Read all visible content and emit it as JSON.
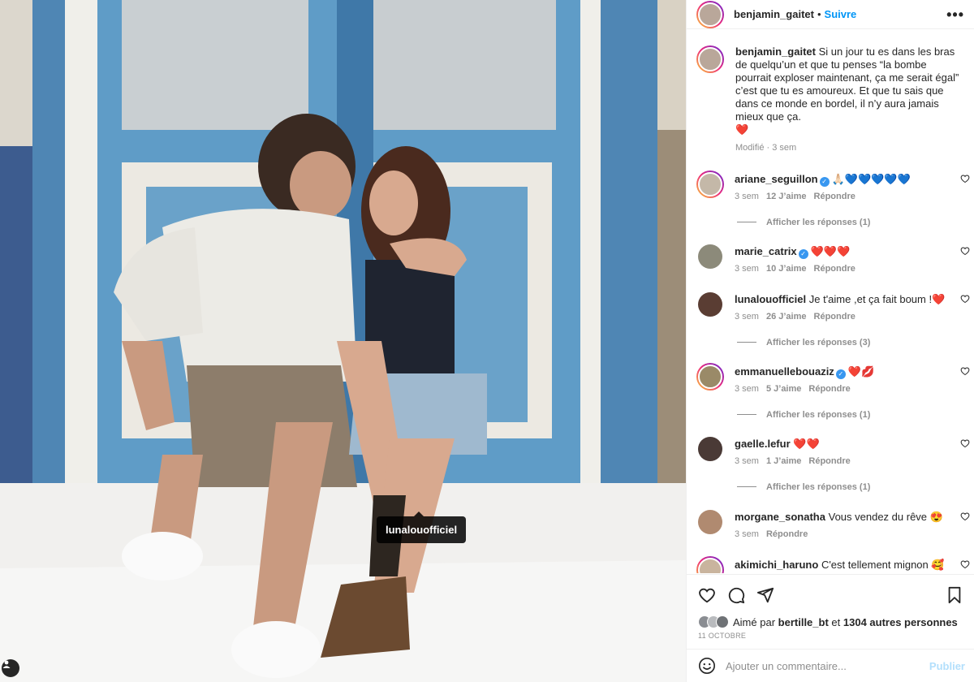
{
  "post": {
    "author": "benjamin_gaitet",
    "follow_label": "Suivre",
    "dot": "•",
    "photo_tag": "lunalouofficiel"
  },
  "caption": {
    "username": "benjamin_gaitet",
    "text": "Si un jour tu es dans les bras de quelqu’un et que tu penses “la bombe pourrait exploser maintenant, ça me serait égal” c’est que tu es amoureux. Et que tu sais que dans ce monde en bordel, il n’y aura jamais mieux que ça.",
    "emoji": "❤️",
    "edited": "Modifié",
    "sep": " · ",
    "time": "3 sem"
  },
  "comments": [
    {
      "username": "ariane_seguillon",
      "verified": true,
      "text": "🙏🏻💙💙💙💙💙",
      "time": "3 sem",
      "likes": "12 J’aime",
      "reply": "Répondre",
      "replies": "Afficher les réponses (1)"
    },
    {
      "username": "marie_catrix",
      "verified": true,
      "text": "❤️❤️❤️",
      "time": "3 sem",
      "likes": "10 J’aime",
      "reply": "Répondre",
      "replies": ""
    },
    {
      "username": "lunalouofficiel",
      "verified": false,
      "text": "Je t'aime ,et ça fait boum !❤️",
      "time": "3 sem",
      "likes": "26 J’aime",
      "reply": "Répondre",
      "replies": "Afficher les réponses (3)"
    },
    {
      "username": "emmanuellebouaziz",
      "verified": true,
      "text": "❤️💋",
      "time": "3 sem",
      "likes": "5 J’aime",
      "reply": "Répondre",
      "replies": "Afficher les réponses (1)"
    },
    {
      "username": "gaelle.lefur",
      "verified": false,
      "text": "❤️❤️",
      "time": "3 sem",
      "likes": "1 J’aime",
      "reply": "Répondre",
      "replies": "Afficher les réponses (1)"
    },
    {
      "username": "morgane_sonatha",
      "verified": false,
      "text": "Vous vendez du rêve 😍",
      "time": "3 sem",
      "likes": "",
      "reply": "Répondre",
      "replies": ""
    },
    {
      "username": "akimichi_haruno",
      "verified": false,
      "text": "C'est tellement mignon 🥰",
      "time": "",
      "likes": "",
      "reply": "",
      "replies": ""
    }
  ],
  "likes": {
    "prefix": "Aimé par",
    "user": "bertille_bt",
    "middle": "et",
    "others": "1304 autres personnes"
  },
  "date": "11 OCTOBRE",
  "add_comment": {
    "placeholder": "Ajouter un commentaire...",
    "publish": "Publier"
  },
  "colors": {
    "link_blue": "#0095f6",
    "meta_grey": "#8e8e8e",
    "door_blue": "#5b98c3"
  },
  "icons": [
    "user-tag-icon",
    "more-options-icon",
    "heart-icon",
    "comment-icon",
    "share-icon",
    "bookmark-icon",
    "emoji-icon",
    "verified-icon"
  ]
}
